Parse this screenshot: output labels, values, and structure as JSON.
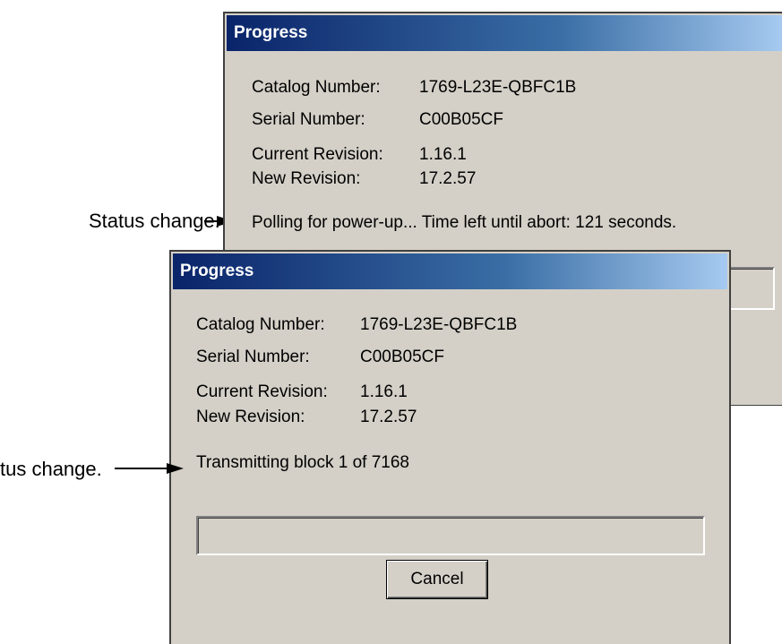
{
  "dialogs": {
    "back": {
      "title": "Progress",
      "catalog_label": "Catalog Number:",
      "catalog_value": "1769-L23E-QBFC1B",
      "serial_label": "Serial Number:",
      "serial_value": "C00B05CF",
      "current_rev_label": "Current Revision:",
      "current_rev_value": "1.16.1",
      "new_rev_label": "New Revision:",
      "new_rev_value": "17.2.57",
      "status": "Polling for power-up... Time left until abort: 121 seconds."
    },
    "front": {
      "title": "Progress",
      "catalog_label": "Catalog Number:",
      "catalog_value": "1769-L23E-QBFC1B",
      "serial_label": "Serial Number:",
      "serial_value": "C00B05CF",
      "current_rev_label": "Current Revision:",
      "current_rev_value": "1.16.1",
      "new_rev_label": "New Revision:",
      "new_rev_value": "17.2.57",
      "status": "Transmitting block 1 of 7168",
      "progress_fraction": 0,
      "cancel_label": "Cancel"
    }
  },
  "annotations": {
    "top_label": "Status change.",
    "bottom_label": "tus change."
  },
  "colors": {
    "dialog_face": "#d4d0c8",
    "title_gradient_start": "#0a246a",
    "title_gradient_end": "#a6caf0",
    "title_text": "#ffffff"
  }
}
